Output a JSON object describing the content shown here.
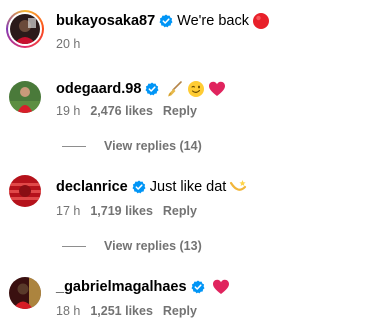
{
  "post": {
    "username": "bukayosaka87",
    "text": "We're back",
    "emoji": "red-circle",
    "time": "20 h"
  },
  "comments": [
    {
      "username": "odegaard.98",
      "text": "",
      "emojis": [
        "broom",
        "winking-face",
        "red-heart"
      ],
      "time": "19 h",
      "likes": "2,476 likes",
      "reply": "Reply",
      "view_replies": "View replies (14)"
    },
    {
      "username": "declanrice",
      "text": "Just like dat",
      "emojis": [
        "dizzy"
      ],
      "time": "17 h",
      "likes": "1,719 likes",
      "reply": "Reply",
      "view_replies": "View replies (13)"
    },
    {
      "username": "_gabrielmagalhaes",
      "text": "",
      "emojis": [
        "red-heart"
      ],
      "time": "18 h",
      "likes": "1,251 likes",
      "reply": "Reply"
    }
  ],
  "colors": {
    "verified": "#0095f6",
    "secondary_text": "#737373",
    "heart": "#e0245e",
    "red_circle": "#e8202a"
  }
}
